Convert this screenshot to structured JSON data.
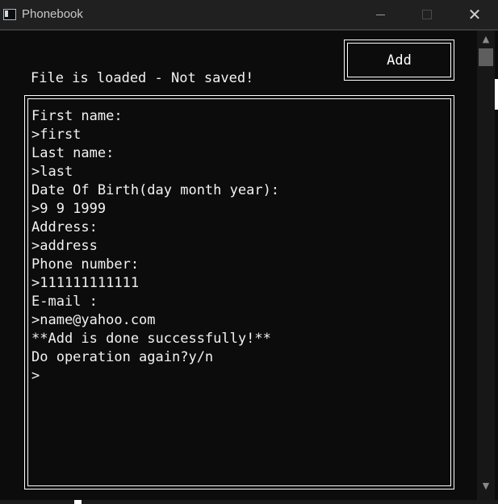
{
  "window": {
    "title": "Phonebook",
    "close_glyph": "✕"
  },
  "toolbar": {
    "add_label": "Add"
  },
  "status": {
    "text": "File is loaded - Not saved!"
  },
  "console": {
    "lines": [
      "First name:",
      ">first",
      "Last name:",
      ">last",
      "Date Of Birth(day month year):",
      ">9 9 1999",
      "Address:",
      ">address",
      "Phone number:",
      ">111111111111",
      "E-mail :",
      ">name@yahoo.com",
      "**Add is done successfully!**",
      "Do operation again?y/n",
      ">"
    ]
  },
  "scrollbar": {
    "up_glyph": "▲",
    "down_glyph": "▼"
  },
  "colors": {
    "background": "#0c0c0c",
    "text": "#f2f2f2",
    "titlebar": "#202020",
    "border": "#ffffff"
  }
}
